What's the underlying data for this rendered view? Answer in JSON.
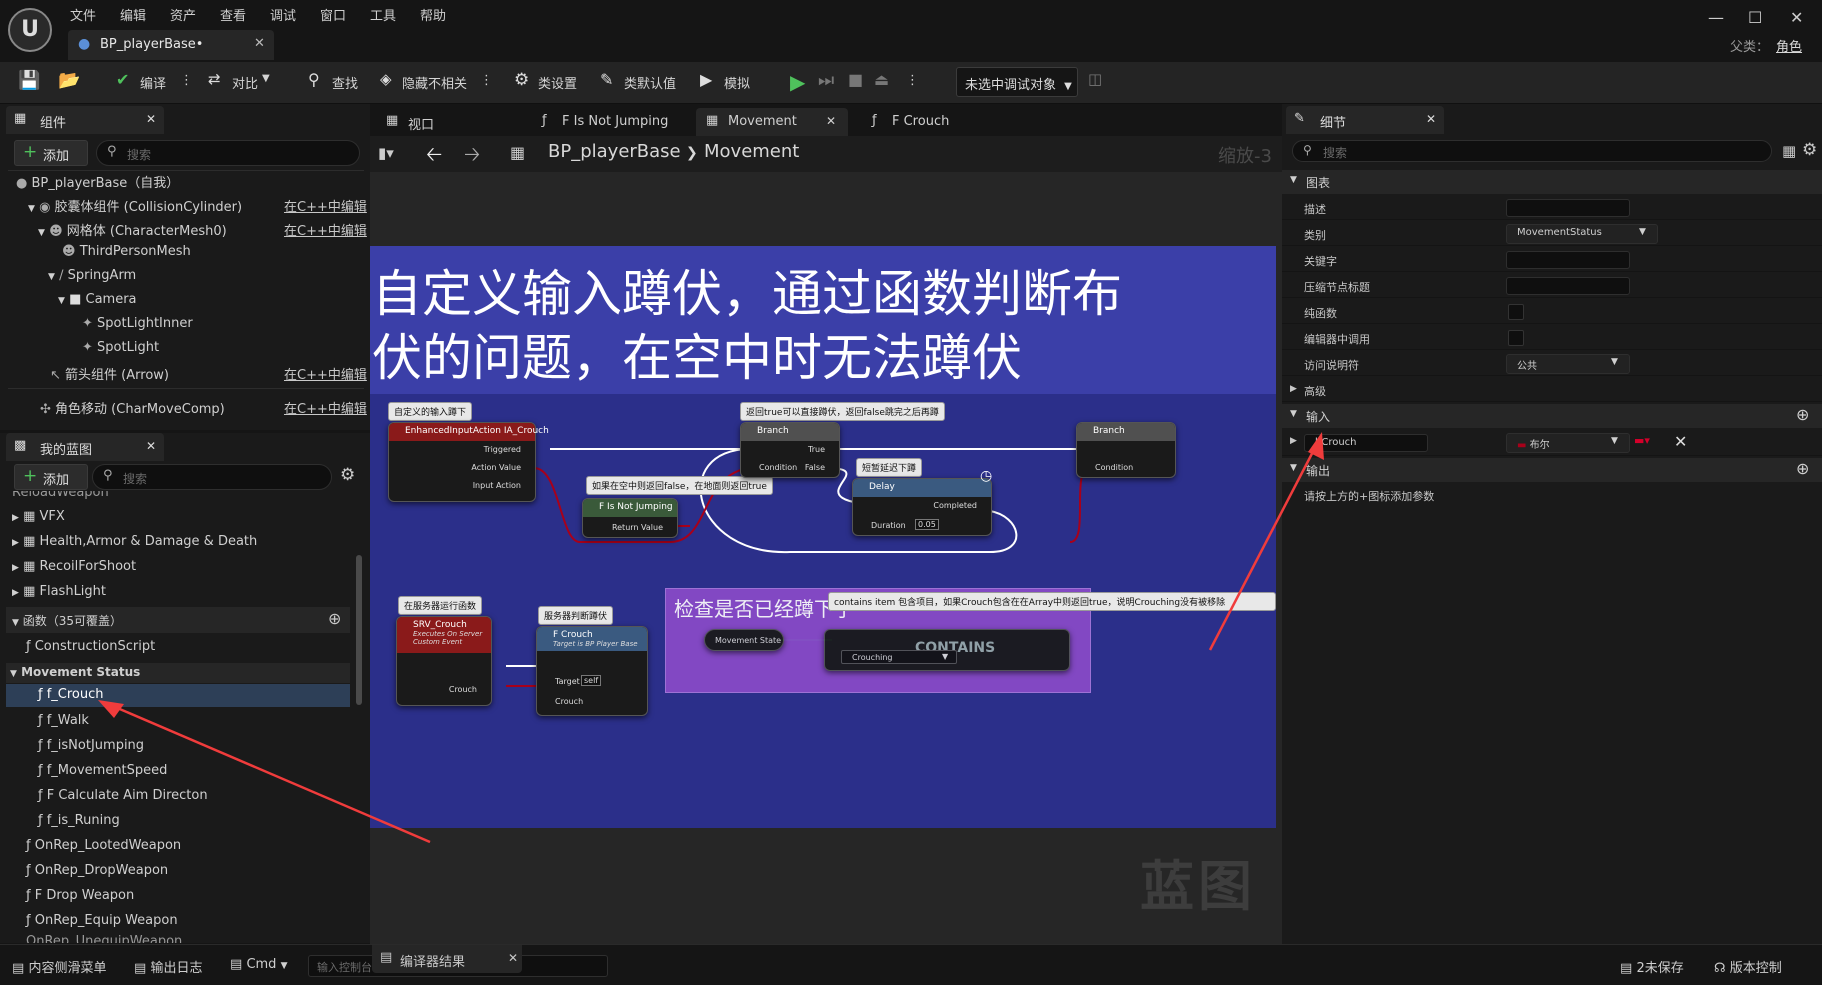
{
  "menu": [
    "文件",
    "编辑",
    "资产",
    "查看",
    "调试",
    "窗口",
    "工具",
    "帮助"
  ],
  "document_tab": "BP_playerBase•",
  "parent_class": {
    "label": "父类：",
    "value": "角色"
  },
  "toolbar": {
    "compile": "编译",
    "diff": "对比",
    "find": "查找",
    "hide_unrelated": "隐藏不相关",
    "class_settings": "类设置",
    "class_defaults": "类默认值",
    "simulate": "模拟",
    "debug_object": "未选中调试对象"
  },
  "components": {
    "tab": "组件",
    "add": "添加",
    "search_placeholder": "搜索",
    "root": "BP_playerBase（自我）",
    "edit_cpp": "在C++中编辑",
    "items": [
      "胶囊体组件 (CollisionCylinder)",
      "网格体 (CharacterMesh0)",
      "ThirdPersonMesh",
      "SpringArm",
      "Camera",
      "SpotLightInner",
      "SpotLight",
      "箭头组件 (Arrow)",
      "角色移动 (CharMoveComp)"
    ]
  },
  "my_blueprint": {
    "tab": "我的蓝图",
    "add": "添加",
    "search_placeholder": "搜索",
    "partial_top": "ReloadWeapon",
    "categories": [
      "VFX",
      "Health,Armor & Damage & Death",
      "RecoilForShoot",
      "FlashLight"
    ],
    "functions_header": "函数（35可覆盖）",
    "construction": "ConstructionScript",
    "group": "Movement Status",
    "group_funcs": [
      "f_Crouch",
      "f_Walk",
      "f_isNotJumping",
      "f_MovementSpeed",
      "F Calculate Aim Directon",
      "f_is_Runing"
    ],
    "funcs": [
      "OnRep_LootedWeapon",
      "OnRep_DropWeapon",
      "F Drop Weapon",
      "OnRep_Equip Weapon"
    ],
    "partial_bottom": "OnRep_UnequipWeapon"
  },
  "center_tabs": [
    "视口",
    "F Is Not Jumping",
    "Movement",
    "F Crouch"
  ],
  "breadcrumb": {
    "bp": "BP_playerBase",
    "graph": "Movement"
  },
  "zoom": "缩放-3",
  "watermark": "蓝图",
  "graph": {
    "banner_line1": "自定义输入蹲伏，通过函数判断布",
    "banner_line2": "伏的问题，在空中时无法蹲伏",
    "bubbles": {
      "b1": "自定义的输入蹲下",
      "b2": "返回true可以直接蹲伏，返回false跳完之后再蹲",
      "b3": "如果在空中则返回false，在地面则返回true",
      "b4": "短暂延迟下蹲",
      "b5": "在服务器运行函数",
      "b6": "服务器判断蹲伏",
      "b7": "contains item 包含项目，如果Crouch包含在在Array中则返回true，说明Crouching没有被移除"
    },
    "enhanced": {
      "title": "EnhancedInputAction IA_Crouch",
      "triggered": "Triggered",
      "action_value": "Action Value",
      "input_action": "Input Action"
    },
    "branch1": {
      "title": "Branch",
      "cond": "Condition",
      "t": "True",
      "f": "False"
    },
    "branch2": {
      "title": "Branch",
      "cond": "Condition"
    },
    "notjump": {
      "title": "F Is Not Jumping",
      "ret": "Return Value"
    },
    "delay": {
      "title": "Delay",
      "completed": "Completed",
      "duration": "Duration",
      "duration_val": "0.05"
    },
    "srv": {
      "title": "SRV_Crouch",
      "sub1": "Executes On Server",
      "sub2": "Custom Event",
      "crouch": "Crouch"
    },
    "fcrouch": {
      "title": "F Crouch",
      "sub": "Target is BP Player Base",
      "target": "Target",
      "target_val": "self",
      "crouch": "Crouch"
    },
    "comment": "检查是否已经蹲下了",
    "movement_state": "Movement State",
    "contains": "CONTAINS",
    "crouching": "Crouching"
  },
  "details": {
    "tab": "细节",
    "search_placeholder": "搜索",
    "graph_section": "图表",
    "rows": [
      "描述",
      "类别",
      "关键字",
      "压缩节点标题",
      "纯函数",
      "编辑器中调用",
      "访问说明符"
    ],
    "category_value": "MovementStatus",
    "access_value": "公共",
    "advanced": "高级",
    "inputs": "输入",
    "param_name": "bCrouch",
    "param_type": "布尔",
    "outputs": "输出",
    "outputs_hint": "请按上方的+图标添加参数"
  },
  "statusbar": {
    "content_drawer": "内容侧滑菜单",
    "output_log": "输出日志",
    "cmd": "Cmd",
    "console_placeholder": "输入控制台命令",
    "compiler_results": "编译器结果",
    "unsaved": "2未保存",
    "source_control": "版本控制"
  },
  "colors": {
    "accent": "#f03c3c",
    "selection": "#2d3f57",
    "banner": "#3b3fa8",
    "graph_area": "#2b2f8a",
    "comment": "#8a4bc8"
  }
}
